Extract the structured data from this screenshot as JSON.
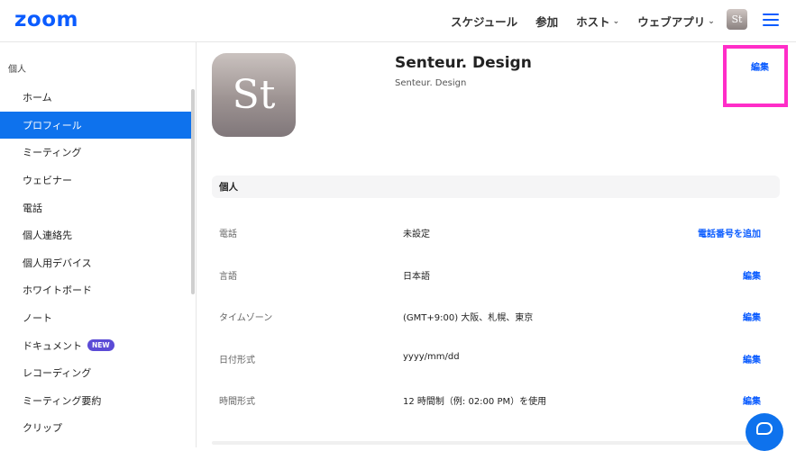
{
  "header": {
    "logo": "zoom",
    "nav": [
      {
        "label": "スケジュール",
        "has_chevron": false
      },
      {
        "label": "参加",
        "has_chevron": false
      },
      {
        "label": "ホスト",
        "has_chevron": true
      },
      {
        "label": "ウェブアプリ",
        "has_chevron": true
      }
    ],
    "avatar_text": "St",
    "chevron": "⌄"
  },
  "sidebar": {
    "section_title": "個人",
    "items": [
      {
        "label": "ホーム"
      },
      {
        "label": "プロフィール",
        "active": true
      },
      {
        "label": "ミーティング"
      },
      {
        "label": "ウェビナー"
      },
      {
        "label": "電話"
      },
      {
        "label": "個人連絡先"
      },
      {
        "label": "個人用デバイス"
      },
      {
        "label": "ホワイトボード"
      },
      {
        "label": "ノート"
      },
      {
        "label": "ドキュメント",
        "badge": "NEW"
      },
      {
        "label": "レコーディング"
      },
      {
        "label": "ミーティング要約"
      },
      {
        "label": "クリップ"
      }
    ]
  },
  "profile": {
    "avatar_text": "St",
    "name": "Senteur. Design",
    "subtitle": "Senteur. Design",
    "edit_label": "編集"
  },
  "personal": {
    "section_title": "個人",
    "rows": [
      {
        "label": "電話",
        "value": "未設定",
        "action": "電話番号を追加"
      },
      {
        "label": "言語",
        "value": "日本語",
        "action": "編集"
      },
      {
        "label": "タイムゾーン",
        "value": "(GMT+9:00) 大阪、札幌、東京",
        "action": "編集"
      },
      {
        "label": "日付形式",
        "value": "yyyy/mm/dd",
        "action": "編集"
      },
      {
        "label": "時間形式",
        "value": "12 時間制（例: 02:00 PM）を使用",
        "action": "編集"
      }
    ]
  },
  "colors": {
    "brand": "#0b5cff",
    "active": "#0e72ed",
    "highlight": "#ff2dc8",
    "badge": "#5b4bd6"
  },
  "icons": {
    "menu": "hamburger-icon",
    "chat": "chat-icon"
  }
}
